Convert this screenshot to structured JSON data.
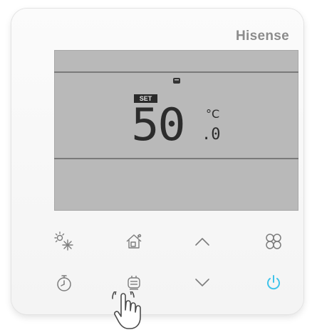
{
  "brand": "Hisense",
  "display": {
    "set_badge": "SET",
    "temperature": "50",
    "unit": "°C",
    "decimal": ".0",
    "mode_icon": "hot-water-tank-icon"
  },
  "buttons": [
    {
      "name": "mode-button",
      "icon": "sun-snowflake-icon"
    },
    {
      "name": "eco-home-button",
      "icon": "house-icon"
    },
    {
      "name": "up-button",
      "icon": "chevron-up-icon"
    },
    {
      "name": "menu-button",
      "icon": "four-circles-icon"
    },
    {
      "name": "timer-button",
      "icon": "stopwatch-icon"
    },
    {
      "name": "hot-water-button",
      "icon": "water-tank-icon"
    },
    {
      "name": "down-button",
      "icon": "chevron-down-icon"
    },
    {
      "name": "power-button",
      "icon": "power-icon"
    }
  ],
  "colors": {
    "power_accent": "#3fc3ea",
    "lcd_background": "#b9b9b9",
    "icon_gray": "#7d7d7d"
  }
}
